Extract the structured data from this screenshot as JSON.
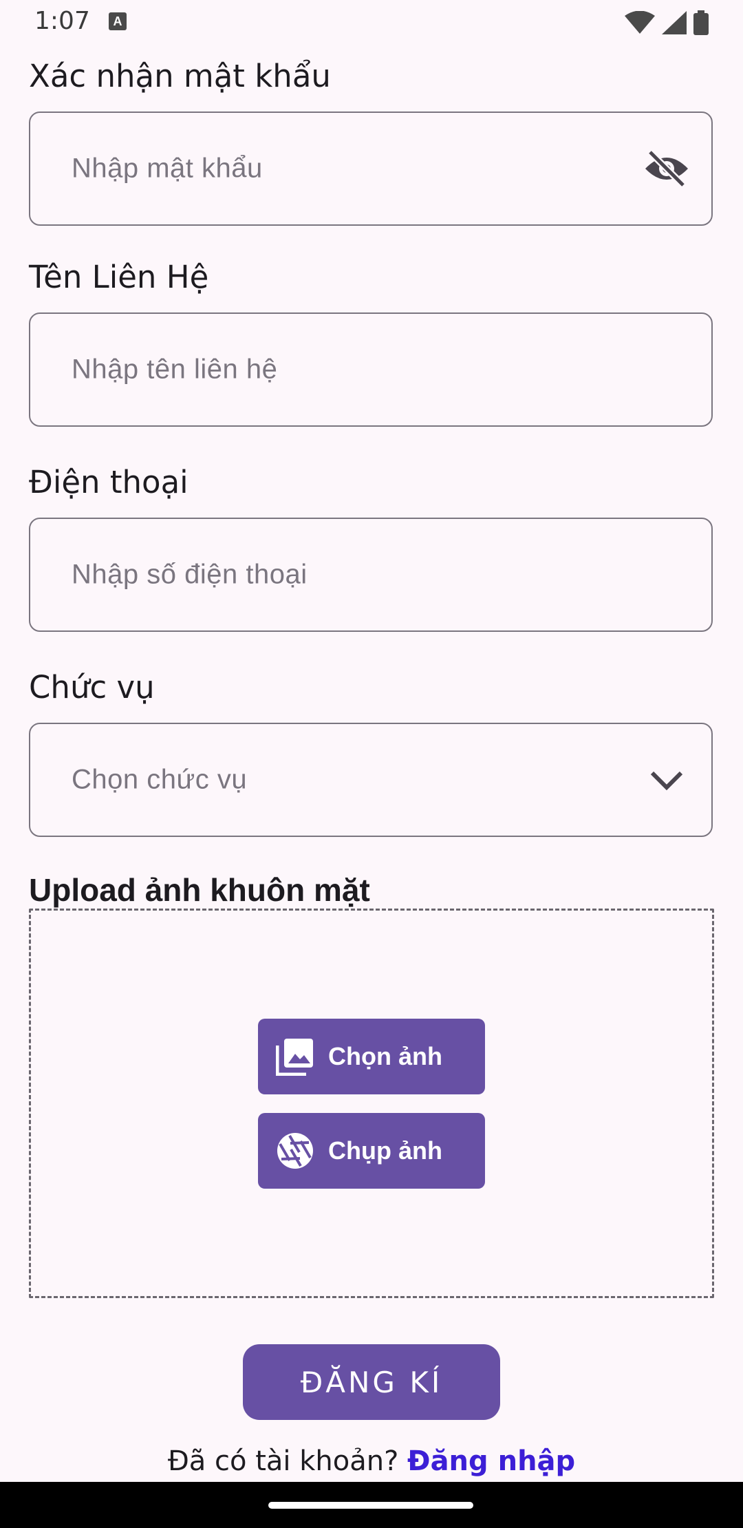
{
  "status_bar": {
    "time": "1:07",
    "notification_badge": "A"
  },
  "form": {
    "confirm_password": {
      "label": "Xác nhận mật khẩu",
      "placeholder": "Nhập mật khẩu",
      "icon": "visibility-off-icon"
    },
    "contact_name": {
      "label": "Tên Liên Hệ",
      "placeholder": "Nhập tên liên hệ"
    },
    "phone": {
      "label": "Điện thoại",
      "placeholder": "Nhập số điện thoại"
    },
    "position": {
      "label": "Chức vụ",
      "placeholder": "Chọn chức vụ",
      "icon": "chevron-down-icon"
    },
    "upload": {
      "label": "Upload ảnh khuôn mặt",
      "choose_photo_label": "Chọn ảnh",
      "choose_photo_icon": "photo-library-icon",
      "take_photo_label": "Chụp ảnh",
      "take_photo_icon": "camera-shutter-icon"
    },
    "submit_label": "ĐĂNG KÍ",
    "login_prompt": "Đã có tài khoản?",
    "login_link": "Đăng nhập"
  },
  "colors": {
    "primary": "#6750a4",
    "background": "#fdf7fb",
    "link": "#3c1fd6",
    "outline": "#7a757f"
  }
}
